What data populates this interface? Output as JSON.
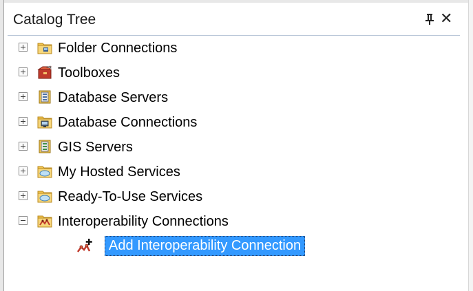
{
  "panel": {
    "title": "Catalog Tree",
    "pin_icon": "pin-icon",
    "close_label": "✕"
  },
  "tree": {
    "nodes": [
      {
        "label": "Folder Connections",
        "expanded": false,
        "icon": "folder-connections-icon"
      },
      {
        "label": "Toolboxes",
        "expanded": false,
        "icon": "toolbox-icon"
      },
      {
        "label": "Database Servers",
        "expanded": false,
        "icon": "database-server-icon"
      },
      {
        "label": "Database Connections",
        "expanded": false,
        "icon": "database-connections-icon"
      },
      {
        "label": "GIS Servers",
        "expanded": false,
        "icon": "gis-servers-icon"
      },
      {
        "label": "My Hosted Services",
        "expanded": false,
        "icon": "hosted-services-icon"
      },
      {
        "label": "Ready-To-Use Services",
        "expanded": false,
        "icon": "ready-to-use-services-icon"
      },
      {
        "label": "Interoperability Connections",
        "expanded": true,
        "icon": "interoperability-icon"
      }
    ],
    "children": [
      {
        "label": "Add Interoperability Connection",
        "selected": true,
        "icon": "add-interoperability-connection-icon"
      }
    ]
  },
  "colors": {
    "selection": "#3399ff",
    "folder_yellow": "#f3c752",
    "toolbox_red": "#c0392b"
  }
}
